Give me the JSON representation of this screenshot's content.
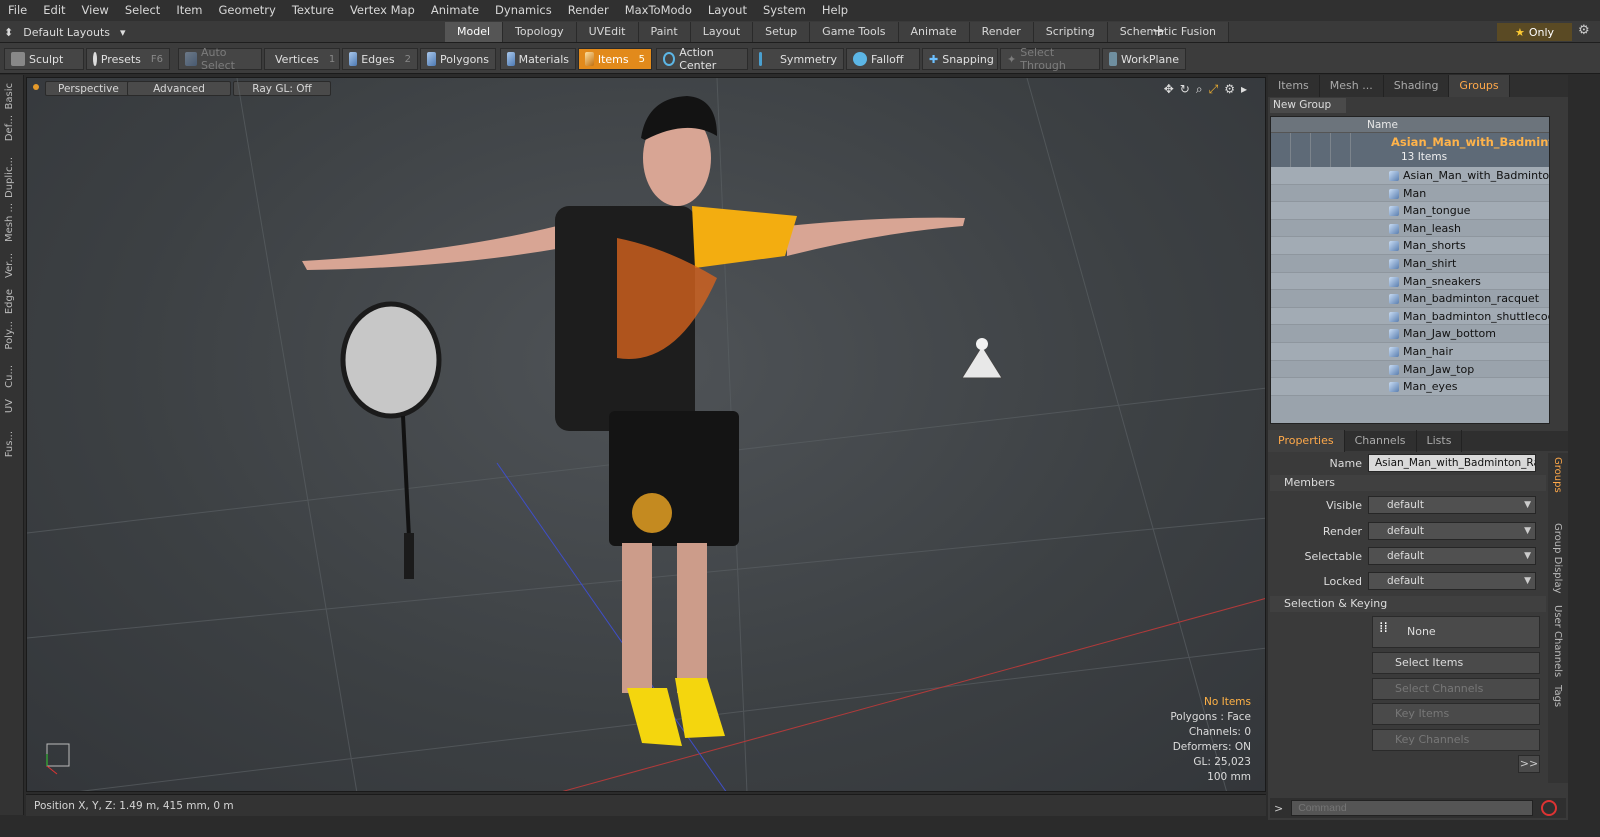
{
  "menu": [
    "File",
    "Edit",
    "View",
    "Select",
    "Item",
    "Geometry",
    "Texture",
    "Vertex Map",
    "Animate",
    "Dynamics",
    "Render",
    "MaxToModo",
    "Layout",
    "System",
    "Help"
  ],
  "layout_select": "Default Layouts",
  "layout_tabs": [
    {
      "label": "Model",
      "active": true
    },
    {
      "label": "Topology"
    },
    {
      "label": "UVEdit"
    },
    {
      "label": "Paint"
    },
    {
      "label": "Layout"
    },
    {
      "label": "Setup"
    },
    {
      "label": "Game Tools"
    },
    {
      "label": "Animate"
    },
    {
      "label": "Render"
    },
    {
      "label": "Scripting"
    },
    {
      "label": "Schematic Fusion"
    }
  ],
  "only_label": "Only",
  "toolbar": {
    "sculpt": "Sculpt",
    "presets": "Presets",
    "presets_key": "F6",
    "auto_select": "Auto Select",
    "vertices": "Vertices",
    "vertices_key": "1",
    "edges": "Edges",
    "edges_key": "2",
    "polygons": "Polygons",
    "materials": "Materials",
    "items": "Items",
    "items_key": "5",
    "action_center": "Action Center",
    "symmetry": "Symmetry",
    "falloff": "Falloff",
    "snapping": "Snapping",
    "select_through": "Select Through",
    "workplane": "WorkPlane"
  },
  "left_tabs": [
    "Basic",
    "Def...",
    "Duplic...",
    "Mesh ...",
    "Ver...",
    "Edge",
    "Poly...",
    "Cu...",
    "UV",
    "Fus..."
  ],
  "viewport": {
    "perspective": "Perspective",
    "advanced": "Advanced",
    "raygl": "Ray GL: Off",
    "hud": {
      "no_items": "No Items",
      "polygons": "Polygons : Face",
      "channels": "Channels: 0",
      "deformers": "Deformers: ON",
      "gl": "GL: 25,023",
      "scale": "100 mm"
    }
  },
  "status": "Position X, Y, Z:   1.49 m, 415 mm, 0 m",
  "right_tabs": [
    {
      "label": "Items"
    },
    {
      "label": "Mesh ..."
    },
    {
      "label": "Shading"
    },
    {
      "label": "Groups",
      "active": true
    }
  ],
  "new_group": "New Group",
  "tree": {
    "header": "Name",
    "group_name": "Asian_Man_with_Badminton_Racquet",
    "group_count": "13 Items",
    "items": [
      "Asian_Man_with_Badminton_Racquet",
      "Man",
      "Man_tongue",
      "Man_leash",
      "Man_shorts",
      "Man_shirt",
      "Man_sneakers",
      "Man_badminton_racquet",
      "Man_badminton_shuttlecock",
      "Man_Jaw_bottom",
      "Man_hair",
      "Man_Jaw_top",
      "Man_eyes"
    ]
  },
  "props_tabs": [
    {
      "label": "Properties",
      "active": true
    },
    {
      "label": "Channels"
    },
    {
      "label": "Lists"
    }
  ],
  "props": {
    "name_label": "Name",
    "name_value": "Asian_Man_with_Badminton_Racquet",
    "members": "Members",
    "visible_label": "Visible",
    "visible_value": "default",
    "render_label": "Render",
    "render_value": "default",
    "selectable_label": "Selectable",
    "selectable_value": "default",
    "locked_label": "Locked",
    "locked_value": "default",
    "sel_keying": "Selection & Keying",
    "none_btn": "None",
    "select_items": "Select Items",
    "select_channels": "Select Channels",
    "key_items": "Key Items",
    "key_channels": "Key Channels",
    "more": ">>"
  },
  "side_tabs": [
    "Groups",
    "Group Display",
    "User Channels",
    "Tags"
  ],
  "command_placeholder": "Command",
  "colors": {
    "accent": "#e28a1b",
    "group_name": "#ffb34a",
    "hud_warn": "#ffb246"
  }
}
